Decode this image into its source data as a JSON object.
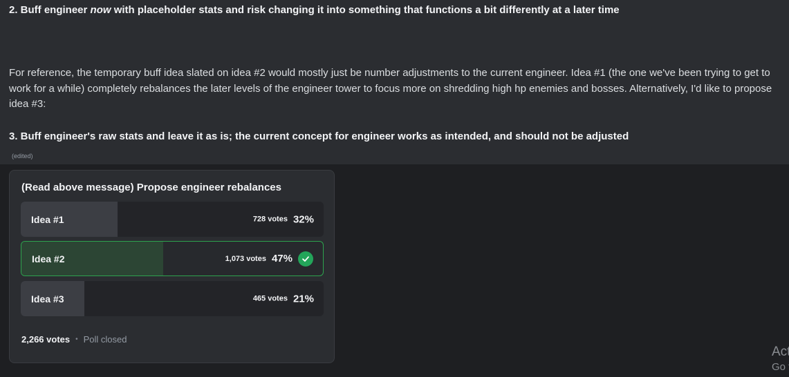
{
  "message": {
    "heading_2_prefix": "2. Buff engineer ",
    "heading_2_emph": "now",
    "heading_2_suffix": " with placeholder stats and risk changing it into something that functions a bit differently at a later time",
    "paragraph": "For reference, the temporary buff idea slated on idea #2 would mostly just be number adjustments to the current engineer. Idea #1 (the one we've been trying to get to work for a while) completely rebalances the later levels of the engineer tower to focus more on shredding high hp enemies and bosses. Alternatively, I'd like to propose idea #3:",
    "heading_3": "3. Buff engineer's raw stats and leave it as is; the current concept for engineer works as intended, and should not be adjusted",
    "edited_tag": "(edited)"
  },
  "poll": {
    "question": "(Read above message) Propose engineer rebalances",
    "options": [
      {
        "label": "Idea #1",
        "votes_text": "728 votes",
        "percent_text": "32%",
        "share": 0.32,
        "winner": false
      },
      {
        "label": "Idea #2",
        "votes_text": "1,073 votes",
        "percent_text": "47%",
        "share": 0.47,
        "winner": true
      },
      {
        "label": "Idea #3",
        "votes_text": "465 votes",
        "percent_text": "21%",
        "share": 0.21,
        "winner": false
      }
    ],
    "total_votes": "2,266 votes",
    "separator": "•",
    "status": "Poll closed"
  },
  "watermark": {
    "line1": "Act",
    "line2": "Go t"
  },
  "colors": {
    "winner_border": "#2da44e",
    "check_badge": "#23a55a"
  },
  "icons": {
    "winner": "check-icon"
  }
}
